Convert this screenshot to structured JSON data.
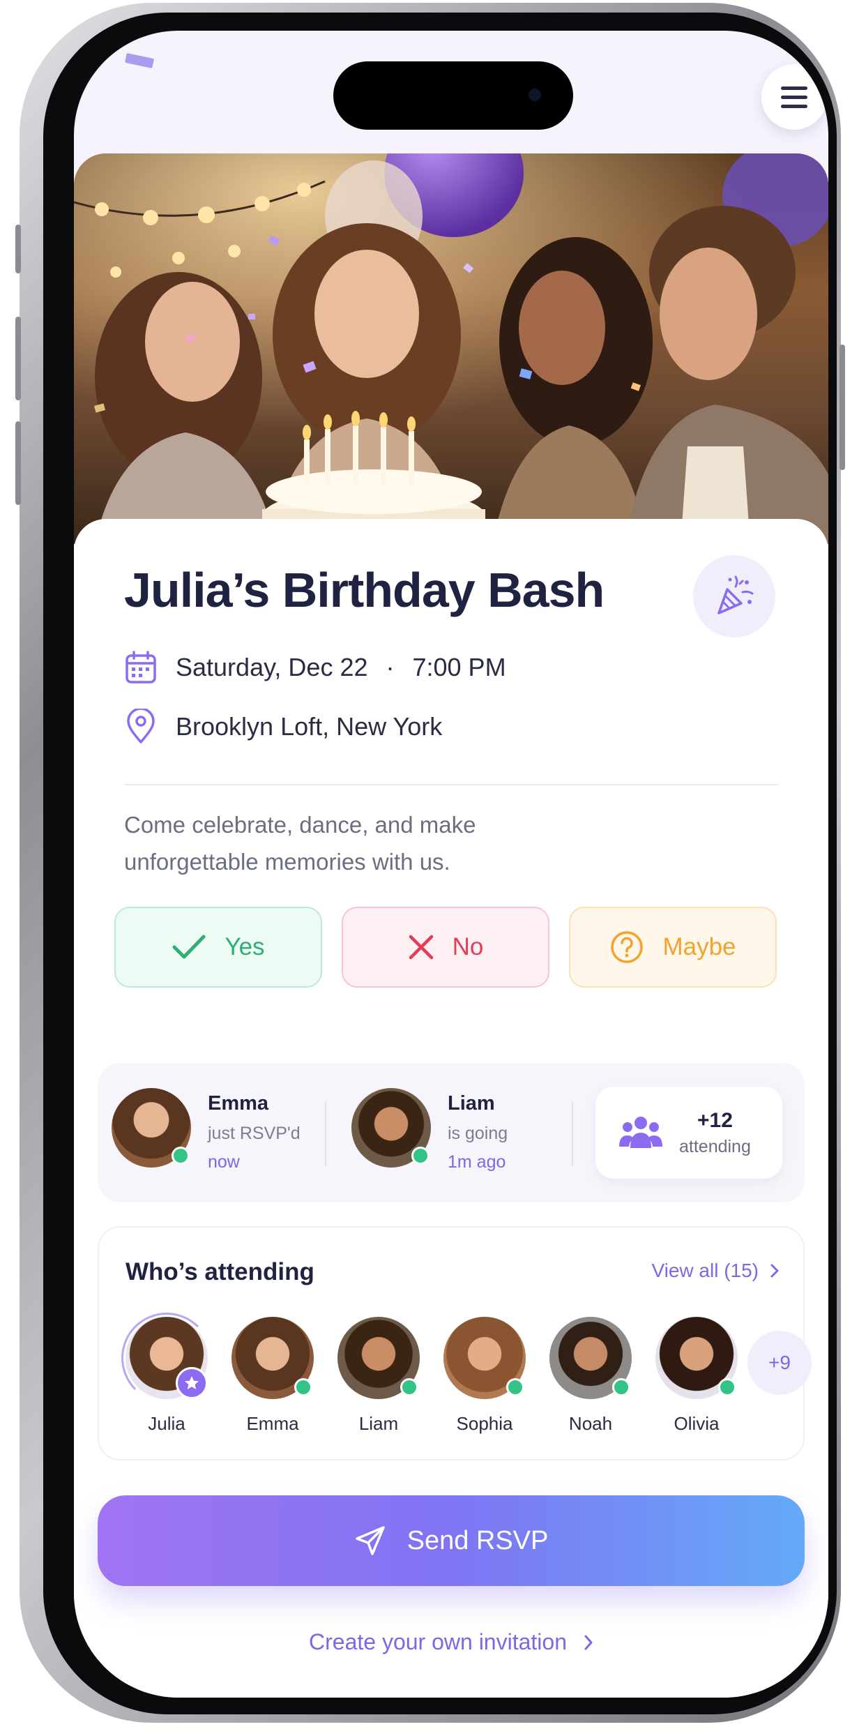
{
  "event": {
    "title": "Julia’s Birthday Bash",
    "date": "Saturday, Dec 22",
    "time": "7:00 PM",
    "separator": "·",
    "location": "Brooklyn Loft, New York",
    "description": "Come celebrate, dance, and make unforgettable memories with us."
  },
  "rsvp_options": {
    "yes": "Yes",
    "no": "No",
    "maybe": "Maybe"
  },
  "activity": [
    {
      "name": "Emma",
      "status": "just RSVP'd",
      "time": "now"
    },
    {
      "name": "Liam",
      "status": "is going",
      "time": "1m ago"
    }
  ],
  "attending_summary": {
    "count": "+12",
    "label": "attending"
  },
  "attendees": {
    "title": "Who’s attending",
    "view_all": "View all (15)",
    "people": [
      "Julia",
      "Emma",
      "Liam",
      "Sophia",
      "Noah",
      "Olivia"
    ],
    "more": "+9"
  },
  "actions": {
    "send": "Send RSVP",
    "create": "Create your own invitation"
  },
  "icons": [
    "menu-icon",
    "party-popper-icon",
    "calendar-icon",
    "location-pin-icon",
    "check-icon",
    "x-icon",
    "question-icon",
    "group-icon",
    "star-icon",
    "chevron-right-icon",
    "send-icon"
  ],
  "colors": {
    "accent": "#7c67e6",
    "yes": "#2fae75",
    "no": "#e33c57",
    "maybe": "#f2a22e",
    "title": "#1f2240"
  }
}
